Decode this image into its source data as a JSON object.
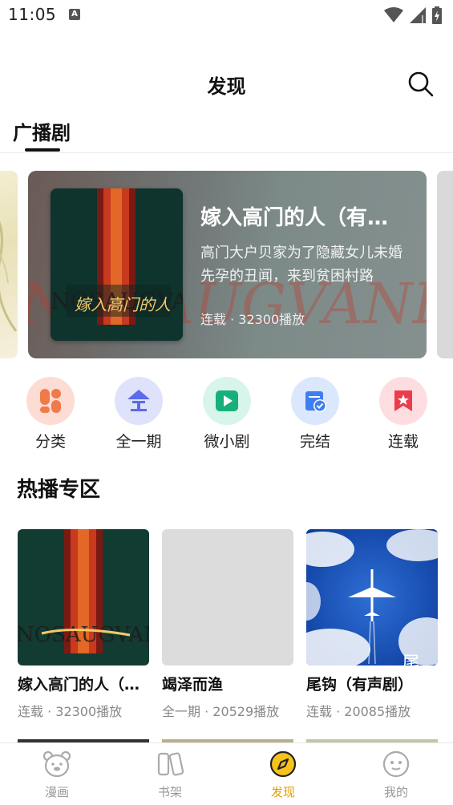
{
  "status": {
    "time": "11:05",
    "notification_letter": "A"
  },
  "header": {
    "title": "发现"
  },
  "tabs": [
    {
      "label": "广播剧"
    }
  ],
  "banner": {
    "title": "嫁入高门的人（有…",
    "description": "高门大户贝家为了隐藏女儿未婚先孕的丑闻，来到贫困村路",
    "meta": "连载 · 32300播放",
    "cover_text": "嫁入高门的人"
  },
  "categories": [
    {
      "label": "分类",
      "icon": "pills-icon",
      "bg": "#fddcd3",
      "fg": "#f07a4a"
    },
    {
      "label": "全一期",
      "icon": "all-icon",
      "bg": "#dfe2fb",
      "fg": "#5b6bea"
    },
    {
      "label": "微小剧",
      "icon": "play-icon",
      "bg": "#d8f5ec",
      "fg": "#18b07a"
    },
    {
      "label": "完结",
      "icon": "calendar-check-icon",
      "bg": "#dbe7fd",
      "fg": "#3f7ef0"
    },
    {
      "label": "连载",
      "icon": "bookmark-star-icon",
      "bg": "#fddde0",
      "fg": "#ec3c4c"
    }
  ],
  "hot": {
    "title": "热播专区",
    "items": [
      {
        "title": "嫁入高门的人（…",
        "meta": "连载 · 32300播放",
        "cover": "red-door"
      },
      {
        "title": "竭泽而渔",
        "meta": "全一期 · 20529播放",
        "cover": "blank"
      },
      {
        "title": "尾钩（有声剧）",
        "meta": "连载 · 20085播放",
        "cover": "airplane",
        "cover_text": "尾钩"
      }
    ]
  },
  "nav": [
    {
      "label": "漫画",
      "icon": "bear-face-icon",
      "active": false
    },
    {
      "label": "书架",
      "icon": "bookshelf-icon",
      "active": false
    },
    {
      "label": "发现",
      "icon": "compass-icon",
      "active": true
    },
    {
      "label": "我的",
      "icon": "smiley-face-icon",
      "active": false
    }
  ],
  "colors": {
    "accent": "#e59e00",
    "text": "#111111",
    "muted": "#888888"
  }
}
